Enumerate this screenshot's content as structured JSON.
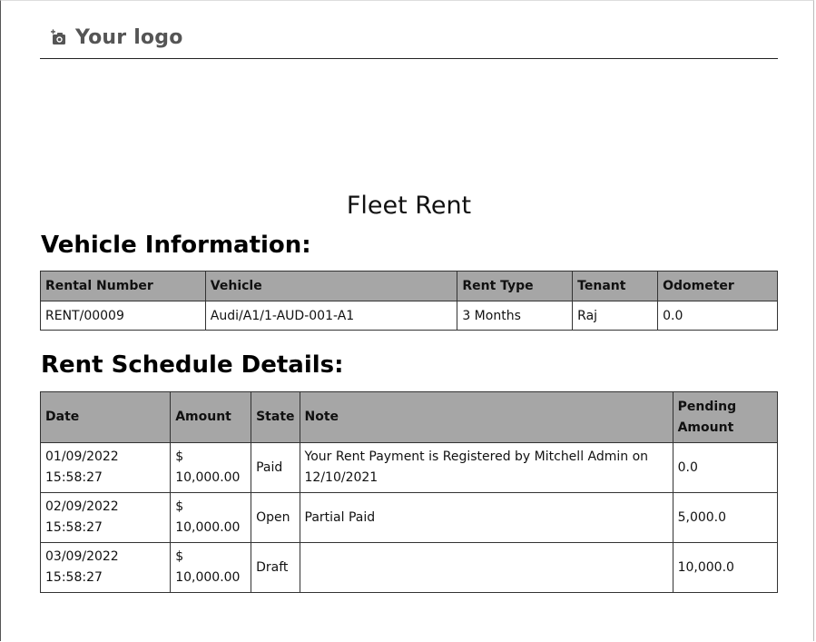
{
  "logo": {
    "icon": "camera-icon",
    "text": "Your logo"
  },
  "title": "Fleet Rent",
  "vehicle_section": {
    "heading": "Vehicle Information:",
    "columns": [
      "Rental Number",
      "Vehicle",
      "Rent Type",
      "Tenant",
      "Odometer"
    ],
    "row": [
      "RENT/00009",
      "Audi/A1/1-AUD-001-A1",
      "3 Months",
      "Raj",
      "0.0"
    ]
  },
  "schedule_section": {
    "heading": "Rent Schedule Details:",
    "columns": [
      "Date",
      "Amount",
      "State",
      "Note",
      "Pending Amount"
    ],
    "rows": [
      {
        "date": "01/09/2022 15:58:27",
        "amount": "$ 10,000.00",
        "state": "Paid",
        "note": "Your Rent Payment is Registered by Mitchell Admin on 12/10/2021",
        "pending": "0.0"
      },
      {
        "date": "02/09/2022 15:58:27",
        "amount": "$ 10,000.00",
        "state": "Open",
        "note": "Partial Paid",
        "pending": "5,000.0"
      },
      {
        "date": "03/09/2022 15:58:27",
        "amount": "$ 10,000.00",
        "state": "Draft",
        "note": "",
        "pending": "10,000.0"
      }
    ]
  },
  "colors": {
    "table_header_bg": "#a6a6a6",
    "logo_text": "#555555",
    "border": "#333333"
  }
}
